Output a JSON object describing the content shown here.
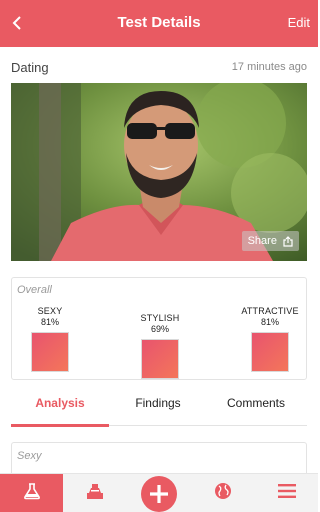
{
  "header": {
    "title": "Test Details",
    "edit_label": "Edit",
    "back_icon": "chevron-left-icon",
    "background": "#e95a62"
  },
  "meta": {
    "category": "Dating",
    "time": "17 minutes ago"
  },
  "photo": {
    "share_label": "Share",
    "share_icon": "share-icon"
  },
  "scores": {
    "title": "Overall",
    "items": [
      {
        "label": "SEXY",
        "value": "81%"
      },
      {
        "label": "STYLISH",
        "value": "69%"
      },
      {
        "label": "ATTRACTIVE",
        "value": "81%"
      }
    ]
  },
  "tabs": [
    {
      "label": "Analysis",
      "active": true
    },
    {
      "label": "Findings",
      "active": false
    },
    {
      "label": "Comments",
      "active": false
    }
  ],
  "detail": {
    "title": "Sexy"
  },
  "bottom_nav": {
    "items": [
      {
        "icon": "flask-icon",
        "active": true
      },
      {
        "icon": "voting-box-icon",
        "active": false
      },
      {
        "icon": "add-icon",
        "active": false
      },
      {
        "icon": "globe-icon",
        "active": false
      },
      {
        "icon": "menu-icon",
        "active": false
      }
    ]
  },
  "colors": {
    "accent": "#e95a62",
    "score_gradient_start": "#e8546e",
    "score_gradient_end": "#f4765a"
  }
}
